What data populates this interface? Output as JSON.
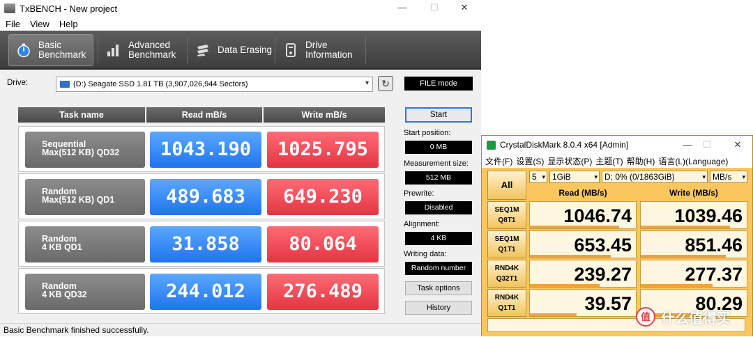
{
  "txbench": {
    "title": "TxBENCH - New project",
    "menu": [
      "File",
      "View",
      "Help"
    ],
    "toolbar": [
      {
        "line1": "Basic",
        "line2": "Benchmark",
        "active": true
      },
      {
        "line1": "Advanced",
        "line2": "Benchmark",
        "active": false
      },
      {
        "line1": "Data Erasing",
        "line2": "",
        "active": false
      },
      {
        "line1": "Drive",
        "line2": "Information",
        "active": false
      }
    ],
    "drive_label": "Drive:",
    "drive_value": "(D:) Seagate SSD  1.81 TB (3,907,026,944 Sectors)",
    "mode": "FILE mode",
    "headers": {
      "task": "Task name",
      "read": "Read mB/s",
      "write": "Write mB/s"
    },
    "rows": [
      {
        "line1": "Sequential",
        "line2": "Max(512 KB) QD32",
        "read": "1043.190",
        "write": "1025.795"
      },
      {
        "line1": "Random",
        "line2": "Max(512 KB) QD1",
        "read": "489.683",
        "write": "649.230"
      },
      {
        "line1": "Random",
        "line2": "4 KB QD1",
        "read": "31.858",
        "write": "80.064"
      },
      {
        "line1": "Random",
        "line2": "4 KB QD32",
        "read": "244.012",
        "write": "276.489"
      }
    ],
    "side": {
      "start": "Start",
      "start_position_label": "Start position:",
      "start_position": "0 MB",
      "measurement_size_label": "Measurement size:",
      "measurement_size": "512 MB",
      "prewrite_label": "Prewrite:",
      "prewrite": "Disabled",
      "alignment_label": "Alignment:",
      "alignment": "4 KB",
      "writing_data_label": "Writing data:",
      "writing_data": "Random number",
      "task_options": "Task options",
      "history": "History"
    },
    "status": "Basic Benchmark finished successfully."
  },
  "cdm": {
    "title": "CrystalDiskMark 8.0.4 x64 [Admin]",
    "menu": [
      "文件(F)",
      "设置(S)",
      "显示状态(P)",
      "主题(T)",
      "帮助(H)",
      "语言(L)(Language)"
    ],
    "all": "All",
    "count": "5",
    "size": "1GiB",
    "drive": "D: 0% (0/1863GiB)",
    "unit": "MB/s",
    "read_header": "Read (MB/s)",
    "write_header": "Write (MB/s)",
    "rows": [
      {
        "line1": "SEQ1M",
        "line2": "Q8T1",
        "read": "1046.74",
        "write": "1039.46"
      },
      {
        "line1": "SEQ1M",
        "line2": "Q1T1",
        "read": "653.45",
        "write": "851.46"
      },
      {
        "line1": "RND4K",
        "line2": "Q32T1",
        "read": "239.27",
        "write": "277.37"
      },
      {
        "line1": "RND4K",
        "line2": "Q1T1",
        "read": "39.57",
        "write": "80.29"
      }
    ]
  },
  "watermark": {
    "badge": "值",
    "text": "什么值得买"
  }
}
